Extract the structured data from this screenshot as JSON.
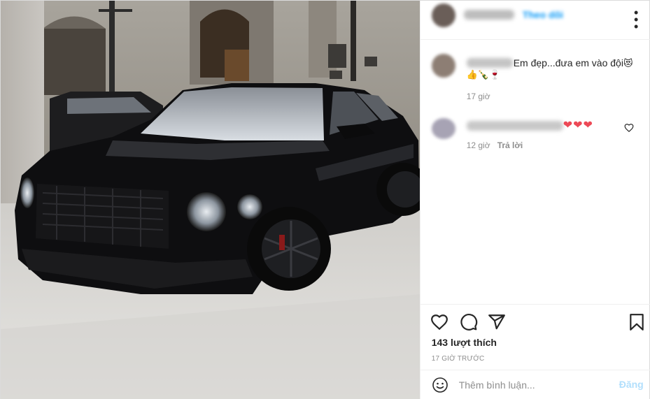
{
  "header": {
    "follow_label": "Theo dõi"
  },
  "comments": [
    {
      "text": "Em đẹp...đưa em vào đội",
      "emoji_inline": "😻",
      "emoji_line": "👍🍾🍷",
      "time": "17 giờ"
    },
    {
      "hearts": "❤❤❤",
      "time": "12 giờ",
      "reply_label": "Trả lời"
    }
  ],
  "actions": {
    "likes": "143 lượt thích",
    "posted_ago": "17 GIỜ TRƯỚC"
  },
  "add_comment": {
    "placeholder": "Thêm bình luận...",
    "post_label": "Đăng"
  },
  "colors": {
    "accent_disabled": "#b2dffc",
    "heart": "#ed4956",
    "muted": "#8e8e8e"
  },
  "icons": [
    "more-options-icon",
    "like-heart-icon",
    "comment-icon",
    "share-icon",
    "save-bookmark-icon",
    "emoji-icon",
    "comment-like-icon"
  ]
}
